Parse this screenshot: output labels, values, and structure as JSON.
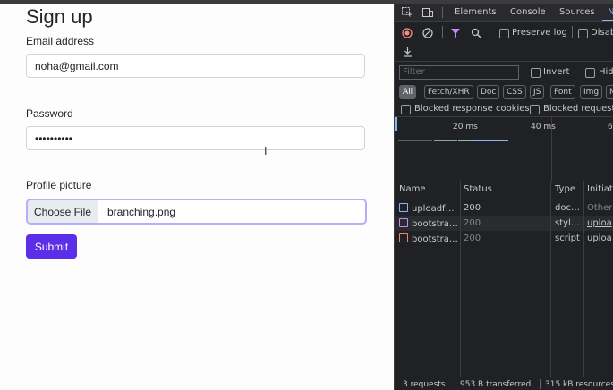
{
  "form": {
    "title": "Sign up",
    "email_label": "Email address",
    "email_value": "noha@gmail.com",
    "password_label": "Password",
    "password_value": "••••••••••",
    "picture_label": "Profile picture",
    "choose_file_label": "Choose File",
    "file_name": "branching.png",
    "submit_label": "Submit",
    "accent_color": "#5b2ee8"
  },
  "devtools": {
    "tabs": [
      "Elements",
      "Console",
      "Sources",
      "N"
    ],
    "active_tab_index": 3,
    "toolbar": {
      "preserve_log": "Preserve log",
      "disable": "Disab"
    },
    "filter_placeholder": "Filter",
    "invert": "Invert",
    "hide": "Hid",
    "type_filters": [
      "All",
      "Fetch/XHR",
      "Doc",
      "CSS",
      "JS",
      "Font",
      "Img",
      "M"
    ],
    "blocked_response_cookies": "Blocked response cookies",
    "blocked_requests": "Blocked requests",
    "timeline_ticks": [
      "20 ms",
      "40 ms",
      "6"
    ],
    "columns": [
      "Name",
      "Status",
      "Type",
      "Initiato"
    ],
    "rows": [
      {
        "name": "uploadf…",
        "status": "200",
        "type": "doc…",
        "initiator": "Other",
        "icon": "document-icon",
        "icon_color": "#8ab4f8"
      },
      {
        "name": "bootstra…",
        "status": "200",
        "type": "styl…",
        "initiator": "uploa",
        "icon": "stylesheet-icon",
        "icon_color": "#c58af9"
      },
      {
        "name": "bootstra…",
        "status": "200",
        "type": "script",
        "initiator": "uploa",
        "icon": "script-icon",
        "icon_color": "#f28b54"
      }
    ],
    "summary": {
      "requests": "3 requests",
      "transferred": "953 B transferred",
      "resources": "315 kB resources"
    }
  }
}
